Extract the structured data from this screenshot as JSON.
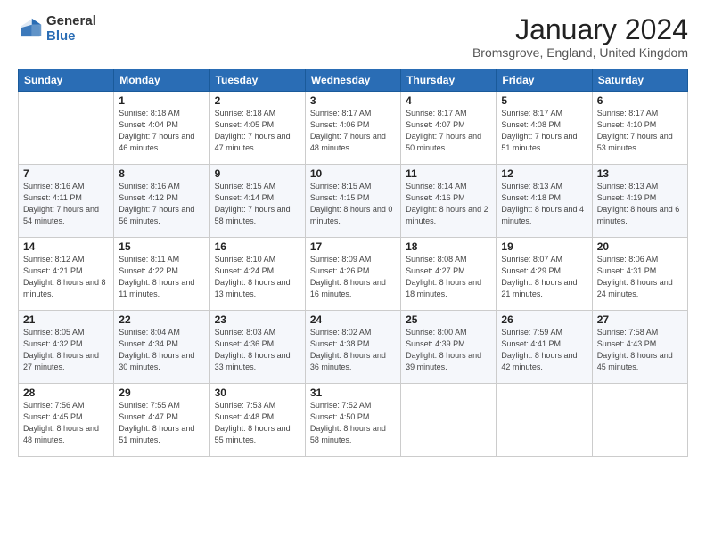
{
  "logo": {
    "general": "General",
    "blue": "Blue"
  },
  "title": {
    "month_year": "January 2024",
    "location": "Bromsgrove, England, United Kingdom"
  },
  "headers": [
    "Sunday",
    "Monday",
    "Tuesday",
    "Wednesday",
    "Thursday",
    "Friday",
    "Saturday"
  ],
  "weeks": [
    [
      {
        "day": "",
        "sunrise": "",
        "sunset": "",
        "daylight": ""
      },
      {
        "day": "1",
        "sunrise": "Sunrise: 8:18 AM",
        "sunset": "Sunset: 4:04 PM",
        "daylight": "Daylight: 7 hours and 46 minutes."
      },
      {
        "day": "2",
        "sunrise": "Sunrise: 8:18 AM",
        "sunset": "Sunset: 4:05 PM",
        "daylight": "Daylight: 7 hours and 47 minutes."
      },
      {
        "day": "3",
        "sunrise": "Sunrise: 8:17 AM",
        "sunset": "Sunset: 4:06 PM",
        "daylight": "Daylight: 7 hours and 48 minutes."
      },
      {
        "day": "4",
        "sunrise": "Sunrise: 8:17 AM",
        "sunset": "Sunset: 4:07 PM",
        "daylight": "Daylight: 7 hours and 50 minutes."
      },
      {
        "day": "5",
        "sunrise": "Sunrise: 8:17 AM",
        "sunset": "Sunset: 4:08 PM",
        "daylight": "Daylight: 7 hours and 51 minutes."
      },
      {
        "day": "6",
        "sunrise": "Sunrise: 8:17 AM",
        "sunset": "Sunset: 4:10 PM",
        "daylight": "Daylight: 7 hours and 53 minutes."
      }
    ],
    [
      {
        "day": "7",
        "sunrise": "Sunrise: 8:16 AM",
        "sunset": "Sunset: 4:11 PM",
        "daylight": "Daylight: 7 hours and 54 minutes."
      },
      {
        "day": "8",
        "sunrise": "Sunrise: 8:16 AM",
        "sunset": "Sunset: 4:12 PM",
        "daylight": "Daylight: 7 hours and 56 minutes."
      },
      {
        "day": "9",
        "sunrise": "Sunrise: 8:15 AM",
        "sunset": "Sunset: 4:14 PM",
        "daylight": "Daylight: 7 hours and 58 minutes."
      },
      {
        "day": "10",
        "sunrise": "Sunrise: 8:15 AM",
        "sunset": "Sunset: 4:15 PM",
        "daylight": "Daylight: 8 hours and 0 minutes."
      },
      {
        "day": "11",
        "sunrise": "Sunrise: 8:14 AM",
        "sunset": "Sunset: 4:16 PM",
        "daylight": "Daylight: 8 hours and 2 minutes."
      },
      {
        "day": "12",
        "sunrise": "Sunrise: 8:13 AM",
        "sunset": "Sunset: 4:18 PM",
        "daylight": "Daylight: 8 hours and 4 minutes."
      },
      {
        "day": "13",
        "sunrise": "Sunrise: 8:13 AM",
        "sunset": "Sunset: 4:19 PM",
        "daylight": "Daylight: 8 hours and 6 minutes."
      }
    ],
    [
      {
        "day": "14",
        "sunrise": "Sunrise: 8:12 AM",
        "sunset": "Sunset: 4:21 PM",
        "daylight": "Daylight: 8 hours and 8 minutes."
      },
      {
        "day": "15",
        "sunrise": "Sunrise: 8:11 AM",
        "sunset": "Sunset: 4:22 PM",
        "daylight": "Daylight: 8 hours and 11 minutes."
      },
      {
        "day": "16",
        "sunrise": "Sunrise: 8:10 AM",
        "sunset": "Sunset: 4:24 PM",
        "daylight": "Daylight: 8 hours and 13 minutes."
      },
      {
        "day": "17",
        "sunrise": "Sunrise: 8:09 AM",
        "sunset": "Sunset: 4:26 PM",
        "daylight": "Daylight: 8 hours and 16 minutes."
      },
      {
        "day": "18",
        "sunrise": "Sunrise: 8:08 AM",
        "sunset": "Sunset: 4:27 PM",
        "daylight": "Daylight: 8 hours and 18 minutes."
      },
      {
        "day": "19",
        "sunrise": "Sunrise: 8:07 AM",
        "sunset": "Sunset: 4:29 PM",
        "daylight": "Daylight: 8 hours and 21 minutes."
      },
      {
        "day": "20",
        "sunrise": "Sunrise: 8:06 AM",
        "sunset": "Sunset: 4:31 PM",
        "daylight": "Daylight: 8 hours and 24 minutes."
      }
    ],
    [
      {
        "day": "21",
        "sunrise": "Sunrise: 8:05 AM",
        "sunset": "Sunset: 4:32 PM",
        "daylight": "Daylight: 8 hours and 27 minutes."
      },
      {
        "day": "22",
        "sunrise": "Sunrise: 8:04 AM",
        "sunset": "Sunset: 4:34 PM",
        "daylight": "Daylight: 8 hours and 30 minutes."
      },
      {
        "day": "23",
        "sunrise": "Sunrise: 8:03 AM",
        "sunset": "Sunset: 4:36 PM",
        "daylight": "Daylight: 8 hours and 33 minutes."
      },
      {
        "day": "24",
        "sunrise": "Sunrise: 8:02 AM",
        "sunset": "Sunset: 4:38 PM",
        "daylight": "Daylight: 8 hours and 36 minutes."
      },
      {
        "day": "25",
        "sunrise": "Sunrise: 8:00 AM",
        "sunset": "Sunset: 4:39 PM",
        "daylight": "Daylight: 8 hours and 39 minutes."
      },
      {
        "day": "26",
        "sunrise": "Sunrise: 7:59 AM",
        "sunset": "Sunset: 4:41 PM",
        "daylight": "Daylight: 8 hours and 42 minutes."
      },
      {
        "day": "27",
        "sunrise": "Sunrise: 7:58 AM",
        "sunset": "Sunset: 4:43 PM",
        "daylight": "Daylight: 8 hours and 45 minutes."
      }
    ],
    [
      {
        "day": "28",
        "sunrise": "Sunrise: 7:56 AM",
        "sunset": "Sunset: 4:45 PM",
        "daylight": "Daylight: 8 hours and 48 minutes."
      },
      {
        "day": "29",
        "sunrise": "Sunrise: 7:55 AM",
        "sunset": "Sunset: 4:47 PM",
        "daylight": "Daylight: 8 hours and 51 minutes."
      },
      {
        "day": "30",
        "sunrise": "Sunrise: 7:53 AM",
        "sunset": "Sunset: 4:48 PM",
        "daylight": "Daylight: 8 hours and 55 minutes."
      },
      {
        "day": "31",
        "sunrise": "Sunrise: 7:52 AM",
        "sunset": "Sunset: 4:50 PM",
        "daylight": "Daylight: 8 hours and 58 minutes."
      },
      {
        "day": "",
        "sunrise": "",
        "sunset": "",
        "daylight": ""
      },
      {
        "day": "",
        "sunrise": "",
        "sunset": "",
        "daylight": ""
      },
      {
        "day": "",
        "sunrise": "",
        "sunset": "",
        "daylight": ""
      }
    ]
  ]
}
